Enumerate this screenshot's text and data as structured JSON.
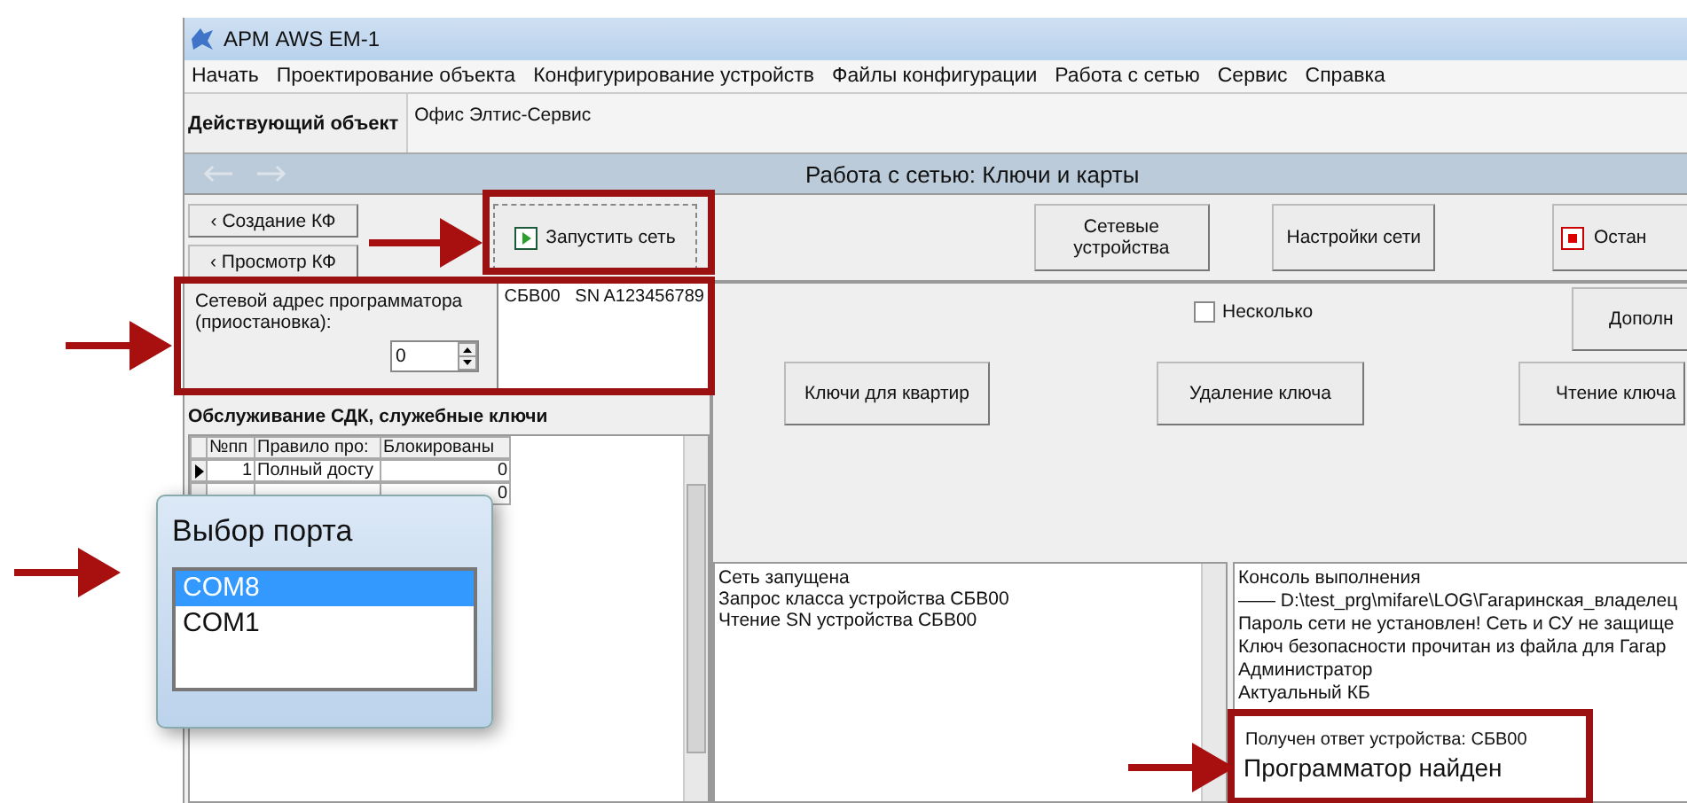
{
  "window": {
    "title": "АРМ AWS EM-1"
  },
  "menu": [
    "Начать",
    "Проектирование объекта",
    "Конфигурирование устройств",
    "Файлы конфигурации",
    "Работа с сетью",
    "Сервис",
    "Справка"
  ],
  "active_object": {
    "label": "Действующий объект",
    "value": "Офис Элтис-Сервис"
  },
  "section": {
    "title": "Работа с сетью: Ключи и карты"
  },
  "nav_buttons": [
    "‹ Создание КФ",
    "‹ Просмотр КФ"
  ],
  "actions": [
    {
      "label": "Запустить сеть",
      "kind": "start"
    },
    {
      "label": "Сетевые устройства",
      "kind": "plain"
    },
    {
      "label": "Настройки сети",
      "kind": "plain"
    },
    {
      "label": "Остан",
      "kind": "stop"
    }
  ],
  "programmer": {
    "label": "Сетевой адрес программатора (приостановка):",
    "address": "0",
    "devices": "СБВ00   SN A123456789"
  },
  "service": {
    "title": "Обслуживание СДК, служебные ключи",
    "columns": [
      "№пп",
      "Правило про:",
      "Блокированы"
    ],
    "rows": [
      {
        "current": true,
        "number": "1",
        "rule": "Полный досту",
        "blocked": "0"
      },
      {
        "current": false,
        "blocked": "0"
      }
    ]
  },
  "keys_panel": {
    "multiple": {
      "label": "Несколько",
      "checked": false
    },
    "more_button": "Дополн",
    "buttons": [
      "Ключи для квартир",
      "Удаление ключа",
      "Чтение ключа"
    ]
  },
  "log": [
    "Сеть запущена",
    "Запрос класса устройства СБВ00",
    "Чтение SN устройства СБВ00"
  ],
  "console": {
    "lines": [
      "Консоль выполнения",
      "—— D:\\test_prg\\mifare\\LOG\\Гагаринская_владелец",
      "Пароль сети не установлен! Сеть и СУ не защище",
      "Ключ безопасности прочитан из файла для Гагар",
      "Администратор",
      "Актуальный КБ"
    ],
    "reply": "Получен ответ устройства: СБВ00",
    "result": "Программатор найден"
  },
  "port_dialog": {
    "title": "Выбор порта",
    "ports": [
      {
        "name": "COM8",
        "selected": true
      },
      {
        "name": "COM1",
        "selected": false
      }
    ]
  }
}
